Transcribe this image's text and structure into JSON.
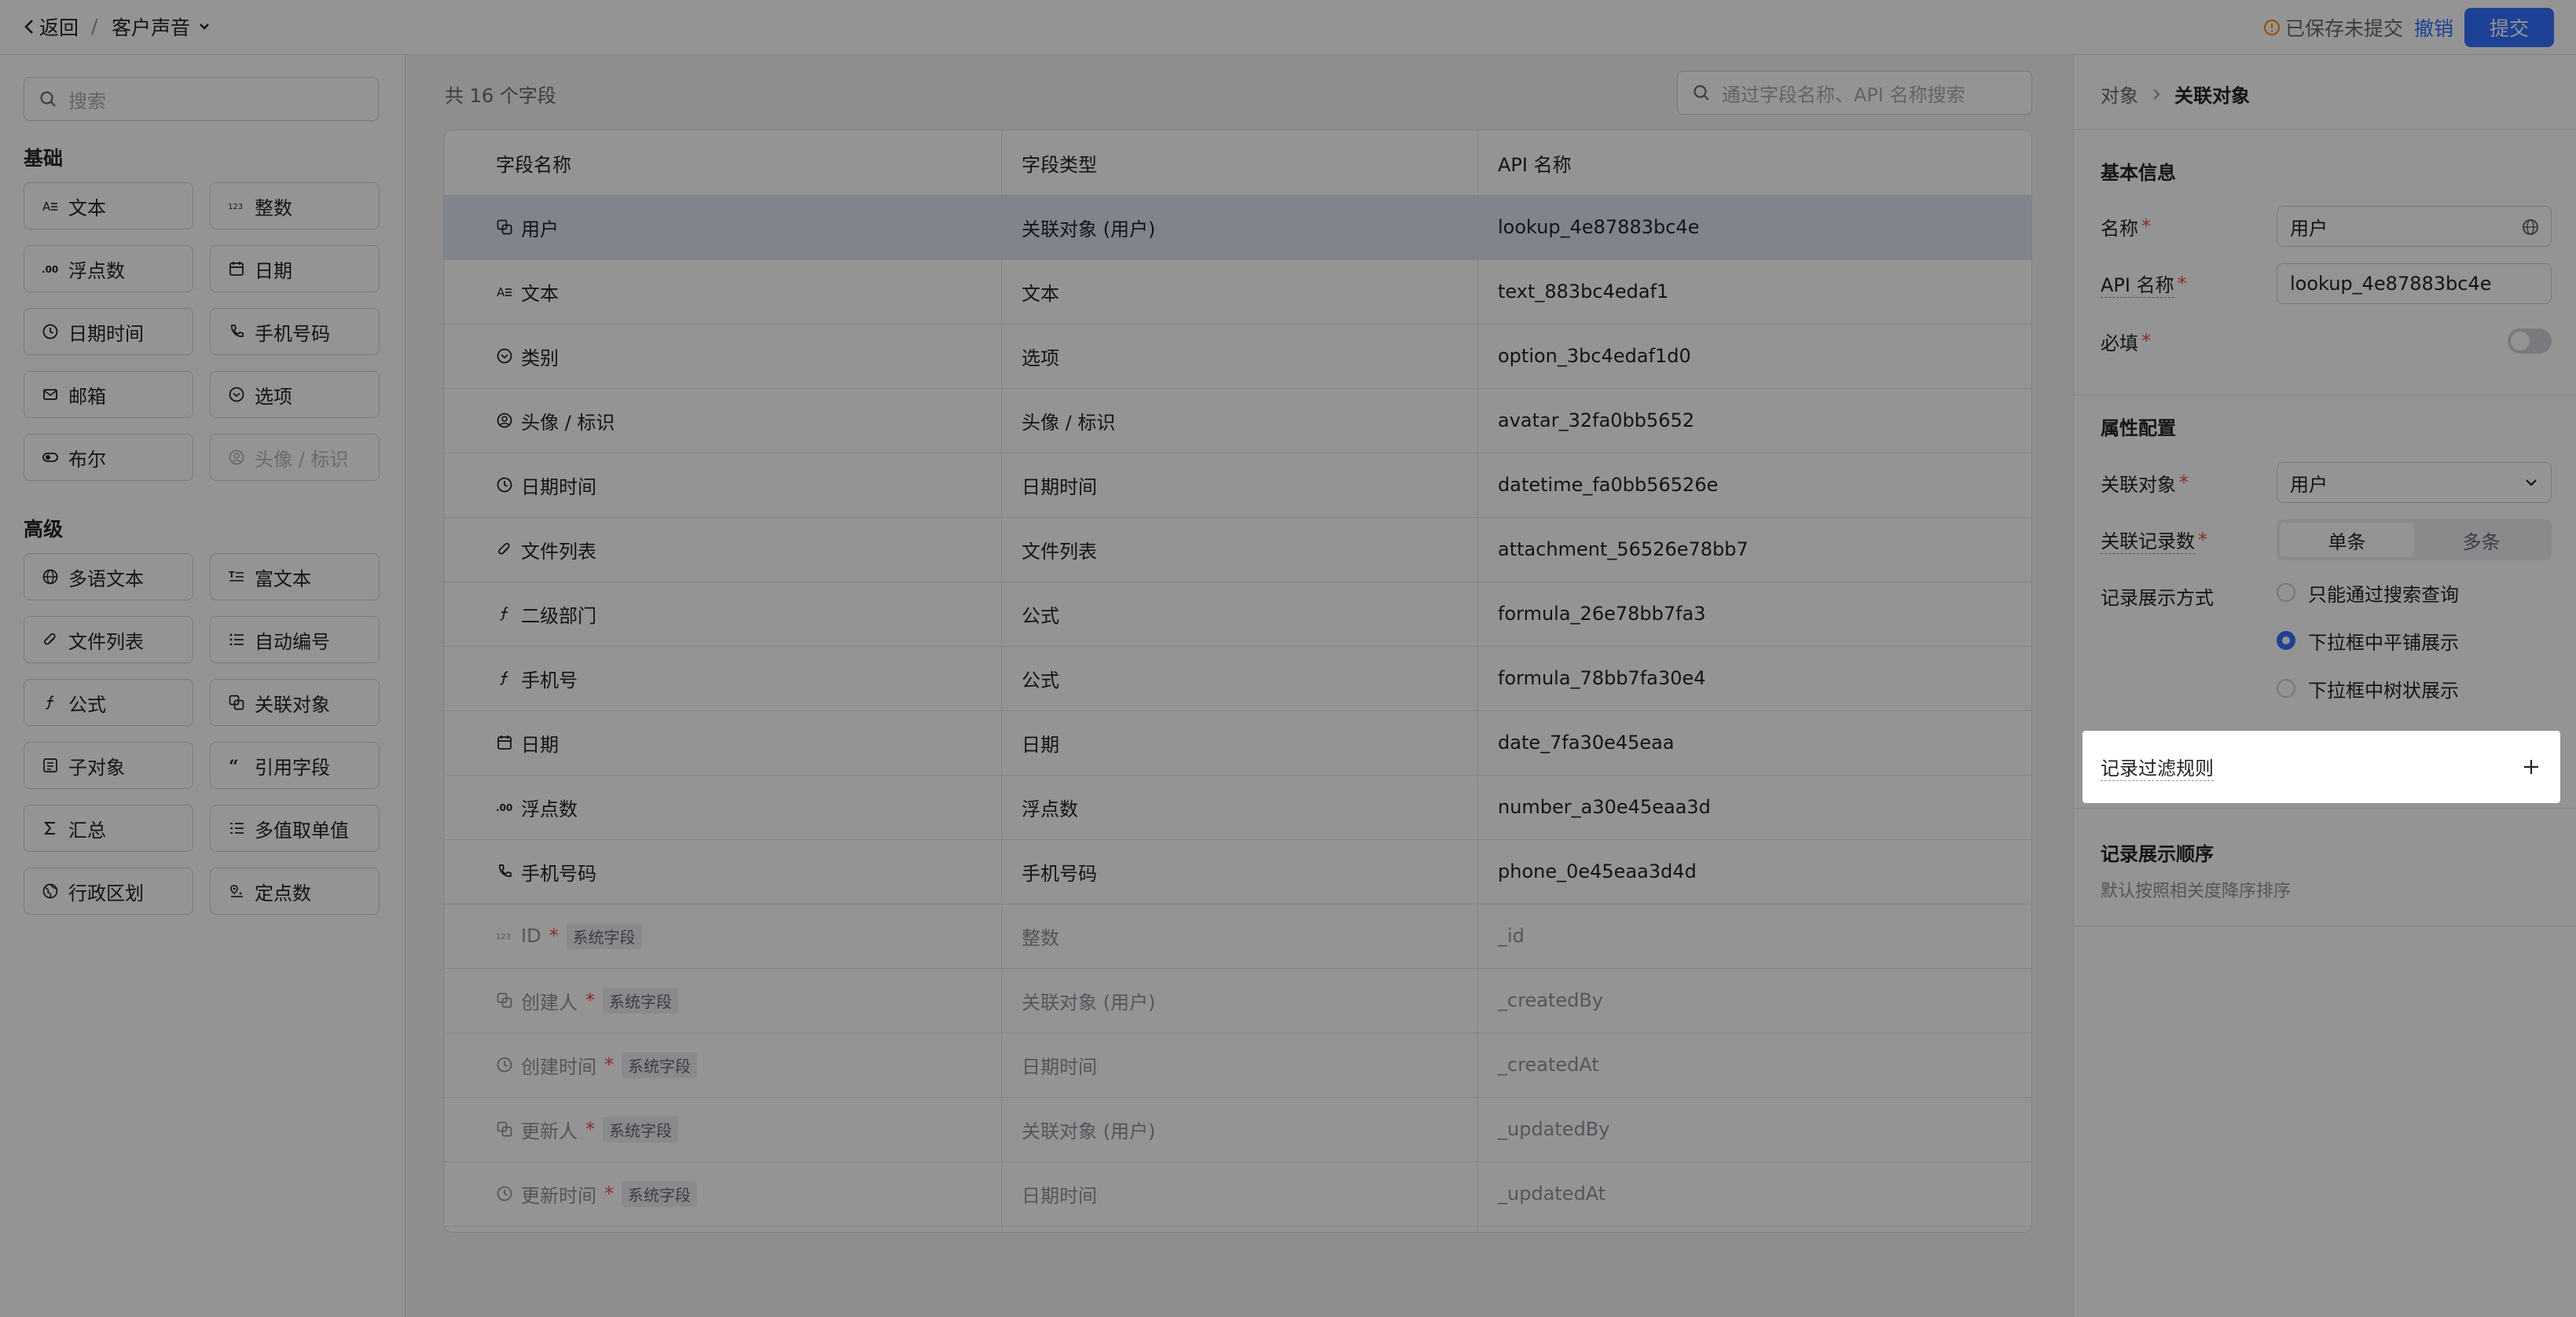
{
  "topbar": {
    "back_label": "返回",
    "separator": "/",
    "app_name": "客户声音",
    "unsaved_label": "已保存未提交",
    "undo_label": "撤销",
    "submit_label": "提交"
  },
  "left_panel": {
    "search_placeholder": "搜索",
    "groups": [
      {
        "title": "基础",
        "items": [
          {
            "label": "文本",
            "icon": "text-icon",
            "disabled": false
          },
          {
            "label": "整数",
            "icon": "integer-icon",
            "disabled": false
          },
          {
            "label": "浮点数",
            "icon": "decimal-icon",
            "disabled": false
          },
          {
            "label": "日期",
            "icon": "calendar-icon",
            "disabled": false
          },
          {
            "label": "日期时间",
            "icon": "clock-icon",
            "disabled": false
          },
          {
            "label": "手机号码",
            "icon": "phone-icon",
            "disabled": false
          },
          {
            "label": "邮箱",
            "icon": "mail-icon",
            "disabled": false
          },
          {
            "label": "选项",
            "icon": "option-icon",
            "disabled": false
          },
          {
            "label": "布尔",
            "icon": "toggle-icon",
            "disabled": false
          },
          {
            "label": "头像 / 标识",
            "icon": "avatar-icon",
            "disabled": true
          }
        ]
      },
      {
        "title": "高级",
        "items": [
          {
            "label": "多语文本",
            "icon": "globe-icon",
            "disabled": false
          },
          {
            "label": "富文本",
            "icon": "richtext-icon",
            "disabled": false
          },
          {
            "label": "文件列表",
            "icon": "attachment-icon",
            "disabled": false
          },
          {
            "label": "自动编号",
            "icon": "autonumber-icon",
            "disabled": false
          },
          {
            "label": "公式",
            "icon": "formula-icon",
            "disabled": false
          },
          {
            "label": "关联对象",
            "icon": "lookup-icon",
            "disabled": false
          },
          {
            "label": "子对象",
            "icon": "subobject-icon",
            "disabled": false
          },
          {
            "label": "引用字段",
            "icon": "quote-icon",
            "disabled": false
          },
          {
            "label": "汇总",
            "icon": "sigma-icon",
            "disabled": false
          },
          {
            "label": "多值取单值",
            "icon": "list-icon",
            "disabled": false
          },
          {
            "label": "行政区划",
            "icon": "region-icon",
            "disabled": false
          },
          {
            "label": "定点数",
            "icon": "fixed-point-icon",
            "disabled": false
          }
        ]
      }
    ]
  },
  "center": {
    "count_label": "共 16 个字段",
    "search_placeholder": "通过字段名称、API 名称搜索",
    "columns": [
      "字段名称",
      "字段类型",
      "API 名称"
    ],
    "system_badge": "系统字段",
    "rows": [
      {
        "name": "用户",
        "type": "关联对象 (用户)",
        "api": "lookup_4e87883bc4e",
        "icon": "lookup-icon",
        "required": false,
        "system": false,
        "selected": true
      },
      {
        "name": "文本",
        "type": "文本",
        "api": "text_883bc4edaf1",
        "icon": "text-icon",
        "required": false,
        "system": false,
        "selected": false
      },
      {
        "name": "类别",
        "type": "选项",
        "api": "option_3bc4edaf1d0",
        "icon": "option-icon",
        "required": false,
        "system": false,
        "selected": false
      },
      {
        "name": "头像 / 标识",
        "type": "头像 / 标识",
        "api": "avatar_32fa0bb5652",
        "icon": "avatar-icon",
        "required": false,
        "system": false,
        "selected": false
      },
      {
        "name": "日期时间",
        "type": "日期时间",
        "api": "datetime_fa0bb56526e",
        "icon": "clock-icon",
        "required": false,
        "system": false,
        "selected": false
      },
      {
        "name": "文件列表",
        "type": "文件列表",
        "api": "attachment_56526e78bb7",
        "icon": "attachment-icon",
        "required": false,
        "system": false,
        "selected": false
      },
      {
        "name": "二级部门",
        "type": "公式",
        "api": "formula_26e78bb7fa3",
        "icon": "formula-icon",
        "required": false,
        "system": false,
        "selected": false
      },
      {
        "name": "手机号",
        "type": "公式",
        "api": "formula_78bb7fa30e4",
        "icon": "formula-icon",
        "required": false,
        "system": false,
        "selected": false
      },
      {
        "name": "日期",
        "type": "日期",
        "api": "date_7fa30e45eaa",
        "icon": "calendar-icon",
        "required": false,
        "system": false,
        "selected": false
      },
      {
        "name": "浮点数",
        "type": "浮点数",
        "api": "number_a30e45eaa3d",
        "icon": "decimal-icon",
        "required": false,
        "system": false,
        "selected": false
      },
      {
        "name": "手机号码",
        "type": "手机号码",
        "api": "phone_0e45eaa3d4d",
        "icon": "phone-icon",
        "required": false,
        "system": false,
        "selected": false
      },
      {
        "name": "ID",
        "type": "整数",
        "api": "_id",
        "icon": "integer-icon",
        "required": true,
        "system": true,
        "selected": false
      },
      {
        "name": "创建人",
        "type": "关联对象 (用户)",
        "api": "_createdBy",
        "icon": "lookup-icon",
        "required": true,
        "system": true,
        "selected": false
      },
      {
        "name": "创建时间",
        "type": "日期时间",
        "api": "_createdAt",
        "icon": "clock-icon",
        "required": true,
        "system": true,
        "selected": false
      },
      {
        "name": "更新人",
        "type": "关联对象 (用户)",
        "api": "_updatedBy",
        "icon": "lookup-icon",
        "required": true,
        "system": true,
        "selected": false
      },
      {
        "name": "更新时间",
        "type": "日期时间",
        "api": "_updatedAt",
        "icon": "clock-icon",
        "required": true,
        "system": true,
        "selected": false
      }
    ]
  },
  "right_panel": {
    "breadcrumb_parent": "对象",
    "breadcrumb_current": "关联对象",
    "basic_title": "基本信息",
    "name_label": "名称",
    "name_value": "用户",
    "api_label": "API 名称",
    "api_value": "lookup_4e87883bc4e",
    "required_label": "必填",
    "required_on": false,
    "attr_title": "属性配置",
    "lookup_label": "关联对象",
    "lookup_value": "用户",
    "record_count_label": "关联记录数",
    "record_count_options": [
      "单条",
      "多条"
    ],
    "record_count_selected": "单条",
    "display_label": "记录展示方式",
    "display_options": [
      "只能通过搜索查询",
      "下拉框中平铺展示",
      "下拉框中树状展示"
    ],
    "display_selected_index": 1,
    "filter_label": "记录过滤规则",
    "sort_title": "记录展示顺序",
    "sort_desc": "默认按照相关度降序排序"
  },
  "colors": {
    "accent": "#3370ff",
    "required_star": "#f54a45",
    "warning": "#ff8800",
    "overlay": "rgba(0,0,0,0.42)"
  }
}
